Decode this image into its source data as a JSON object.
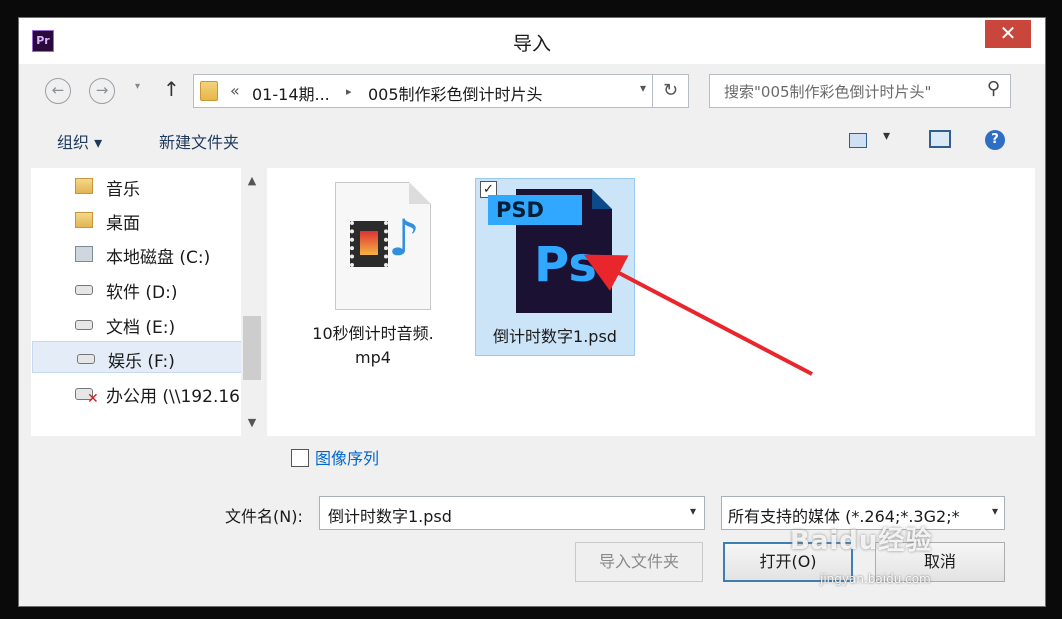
{
  "window": {
    "title": "导入",
    "app_badge": "Pr",
    "close_glyph": "✕"
  },
  "nav": {
    "back_glyph": "←",
    "forward_glyph": "→",
    "dropdown_glyph": "▾",
    "up_glyph": "↑",
    "breadcrumb_prefix": "«",
    "breadcrumb": [
      "01-14期...",
      "005制作彩色倒计时片头"
    ],
    "separator": "▸",
    "refresh_glyph": "↻",
    "search_placeholder": "搜索\"005制作彩色倒计时片头\"",
    "search_glyph": "⚲"
  },
  "toolbar": {
    "organize": "组织 ▾",
    "new_folder": "新建文件夹",
    "view_drop": "▾",
    "help_glyph": "?"
  },
  "sidebar": {
    "items": [
      {
        "label": "音乐",
        "icon": "music-folder-icon"
      },
      {
        "label": "桌面",
        "icon": "desktop-folder-icon"
      },
      {
        "label": "本地磁盘 (C:)",
        "icon": "system-drive-icon"
      },
      {
        "label": "软件 (D:)",
        "icon": "drive-icon"
      },
      {
        "label": "文档 (E:)",
        "icon": "drive-icon"
      },
      {
        "label": "娱乐 (F:)",
        "icon": "drive-icon",
        "selected": true
      },
      {
        "label": "办公用 (\\\\192.16",
        "icon": "network-drive-disconnected-icon"
      }
    ],
    "scroll_up": "▲",
    "scroll_down": "▼"
  },
  "files": [
    {
      "name_line1": "10秒倒计时音频.",
      "name_line2": "mp4",
      "type": "video"
    },
    {
      "name": "倒计时数字1.psd",
      "type": "psd",
      "badge": "PSD",
      "logo": "Ps",
      "check": "✓",
      "selected": true
    }
  ],
  "footer": {
    "image_sequence": "图像序列",
    "filename_label": "文件名(N):",
    "filename_value": "倒计时数字1.psd",
    "filetype_value": "所有支持的媒体 (*.264;*.3G2;*",
    "import_folder": "导入文件夹",
    "open": "打开(O)",
    "cancel": "取消"
  },
  "watermark": {
    "main": "Baidu经验",
    "sub": "jingyan.baidu.com"
  },
  "colors": {
    "accent": "#3c7fb1",
    "close": "#c9463d",
    "annotation_arrow": "#e8262b",
    "ps_blue": "#31a8ff"
  }
}
